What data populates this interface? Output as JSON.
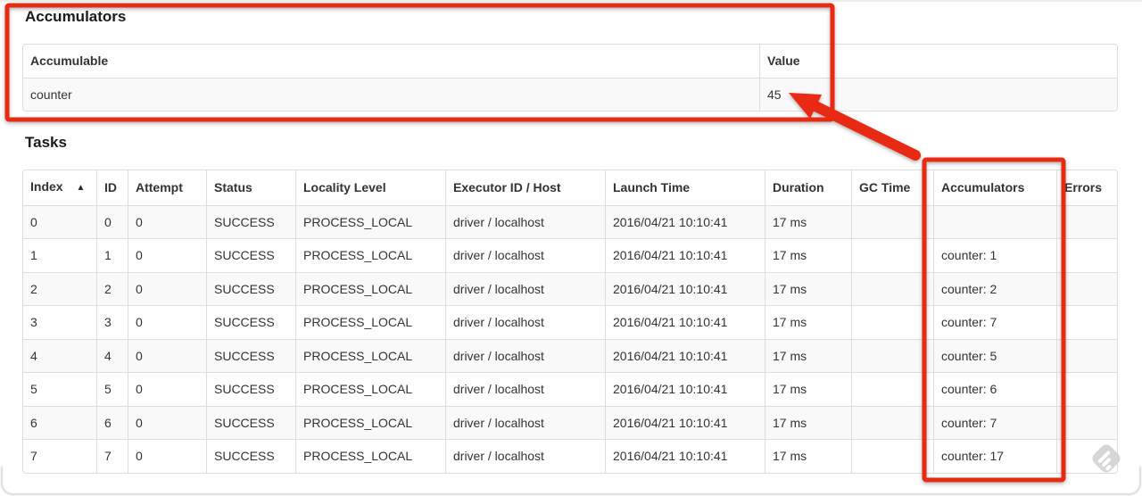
{
  "accumulators_section": {
    "heading": "Accumulators",
    "table": {
      "headers": [
        "Accumulable",
        "Value"
      ],
      "rows": [
        [
          "counter",
          "45"
        ]
      ]
    }
  },
  "tasks_section": {
    "heading": "Tasks",
    "table": {
      "headers": [
        "Index",
        "ID",
        "Attempt",
        "Status",
        "Locality Level",
        "Executor ID / Host",
        "Launch Time",
        "Duration",
        "GC Time",
        "Accumulators",
        "Errors"
      ],
      "sort_icon": "▲",
      "rows": [
        [
          "0",
          "0",
          "0",
          "SUCCESS",
          "PROCESS_LOCAL",
          "driver / localhost",
          "2016/04/21 10:10:41",
          "17 ms",
          "",
          "",
          ""
        ],
        [
          "1",
          "1",
          "0",
          "SUCCESS",
          "PROCESS_LOCAL",
          "driver / localhost",
          "2016/04/21 10:10:41",
          "17 ms",
          "",
          "counter: 1",
          ""
        ],
        [
          "2",
          "2",
          "0",
          "SUCCESS",
          "PROCESS_LOCAL",
          "driver / localhost",
          "2016/04/21 10:10:41",
          "17 ms",
          "",
          "counter: 2",
          ""
        ],
        [
          "3",
          "3",
          "0",
          "SUCCESS",
          "PROCESS_LOCAL",
          "driver / localhost",
          "2016/04/21 10:10:41",
          "17 ms",
          "",
          "counter: 7",
          ""
        ],
        [
          "4",
          "4",
          "0",
          "SUCCESS",
          "PROCESS_LOCAL",
          "driver / localhost",
          "2016/04/21 10:10:41",
          "17 ms",
          "",
          "counter: 5",
          ""
        ],
        [
          "5",
          "5",
          "0",
          "SUCCESS",
          "PROCESS_LOCAL",
          "driver / localhost",
          "2016/04/21 10:10:41",
          "17 ms",
          "",
          "counter: 6",
          ""
        ],
        [
          "6",
          "6",
          "0",
          "SUCCESS",
          "PROCESS_LOCAL",
          "driver / localhost",
          "2016/04/21 10:10:41",
          "17 ms",
          "",
          "counter: 7",
          ""
        ],
        [
          "7",
          "7",
          "0",
          "SUCCESS",
          "PROCESS_LOCAL",
          "driver / localhost",
          "2016/04/21 10:10:41",
          "17 ms",
          "",
          "counter: 17",
          ""
        ]
      ]
    }
  },
  "annotations": {
    "color": "#e82a14",
    "arrow_points_to_value": "45"
  },
  "colors": {
    "table_border": "#dddddd",
    "row_stripe": "#f9f9f9",
    "cell_text": "#333333",
    "watermark": "#d4d4d4"
  }
}
